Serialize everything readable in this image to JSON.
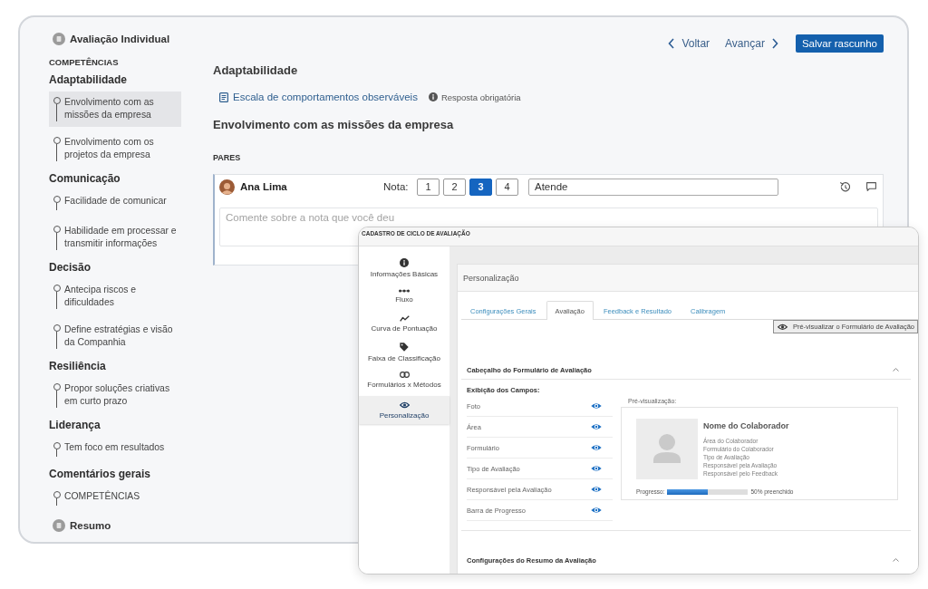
{
  "sidebar": {
    "header": "Avaliação Individual",
    "section_label": "COMPETÊNCIAS",
    "groups": [
      {
        "title": "Adaptabilidade",
        "items": [
          {
            "label": "Envolvimento com as missões da empresa",
            "selected": true
          },
          {
            "label": "Envolvimento com os projetos da empresa",
            "selected": false
          }
        ]
      },
      {
        "title": "Comunicação",
        "items": [
          {
            "label": "Facilidade de comunicar",
            "selected": false
          },
          {
            "label": "Habilidade em processar e transmitir informações",
            "selected": false
          }
        ]
      },
      {
        "title": "Decisão",
        "items": [
          {
            "label": "Antecipa riscos e dificuldades",
            "selected": false
          },
          {
            "label": "Define estratégias e visão da Companhia",
            "selected": false
          }
        ]
      },
      {
        "title": "Resiliência",
        "items": [
          {
            "label": "Propor soluções criativas em curto prazo",
            "selected": false
          }
        ]
      },
      {
        "title": "Liderança",
        "items": [
          {
            "label": "Tem foco em resultados",
            "selected": false
          }
        ]
      },
      {
        "title": "Comentários gerais",
        "items": [
          {
            "label": "COMPETÊNCIAS",
            "selected": false
          }
        ]
      }
    ],
    "footer": "Resumo"
  },
  "toolbar": {
    "back": "Voltar",
    "next": "Avançar",
    "save": "Salvar rascunho"
  },
  "competency": {
    "title": "Adaptabilidade",
    "scale_link": "Escala de comportamentos observáveis",
    "required_note": "Resposta obrigatória",
    "question": "Envolvimento com as missões da empresa"
  },
  "peers": {
    "label": "PARES",
    "evaluations": [
      {
        "name": "Ana Lima",
        "grade_label": "Nota:",
        "grades": [
          {
            "label": "1",
            "selected": false
          },
          {
            "label": "2",
            "selected": false
          },
          {
            "label": "3",
            "selected": true
          },
          {
            "label": "4",
            "selected": false
          }
        ],
        "grade_text": "Atende",
        "comment_placeholder": "Comente sobre a nota que você deu"
      }
    ]
  },
  "cycle_window": {
    "title": "CADASTRO DE CICLO DE AVALIAÇÃO",
    "nav": [
      {
        "label": "Informações Básicas",
        "selected": false
      },
      {
        "label": "Fluxo",
        "selected": false
      },
      {
        "label": "Curva de Pontuação",
        "selected": false
      },
      {
        "label": "Faixa de Classificação",
        "selected": false
      },
      {
        "label": "Formulários x Métodos",
        "selected": false
      },
      {
        "label": "Personalização",
        "selected": true
      }
    ],
    "panel_title": "Personalização",
    "tabs": [
      {
        "label": "Configurações Gerais",
        "selected": false
      },
      {
        "label": "Avaliação",
        "selected": true
      },
      {
        "label": "Feedback e Resultado",
        "selected": false
      },
      {
        "label": "Calibragem",
        "selected": false
      }
    ],
    "preview_button": "Pré-visualizar o Formulário de Avaliação",
    "header_section": {
      "title": "Cabeçalho do Formulário de Avaliação",
      "expanded": true,
      "fields_label": "Exibição dos Campos:",
      "fields": [
        {
          "label": "Foto",
          "visible": true
        },
        {
          "label": "Área",
          "visible": true
        },
        {
          "label": "Formulário",
          "visible": true
        },
        {
          "label": "Tipo de Avaliação",
          "visible": true
        },
        {
          "label": "Responsável pela Avaliação",
          "visible": true
        },
        {
          "label": "Barra de Progresso",
          "visible": true
        }
      ],
      "preview": {
        "label": "Pré-visualização:",
        "name": "Nome do Colaborador",
        "details": [
          "Área do Colaborador",
          "Formulário do Colaborador",
          "Tipo de Avaliação",
          "Responsável pela Avaliação",
          "Responsável pelo Feedback"
        ],
        "progress_label": "Progresso:",
        "level": 0.5,
        "progress_text": "50% preenchido"
      }
    },
    "summary_section": {
      "title": "Configurações do Resumo da Avaliação",
      "expanded": true
    }
  }
}
